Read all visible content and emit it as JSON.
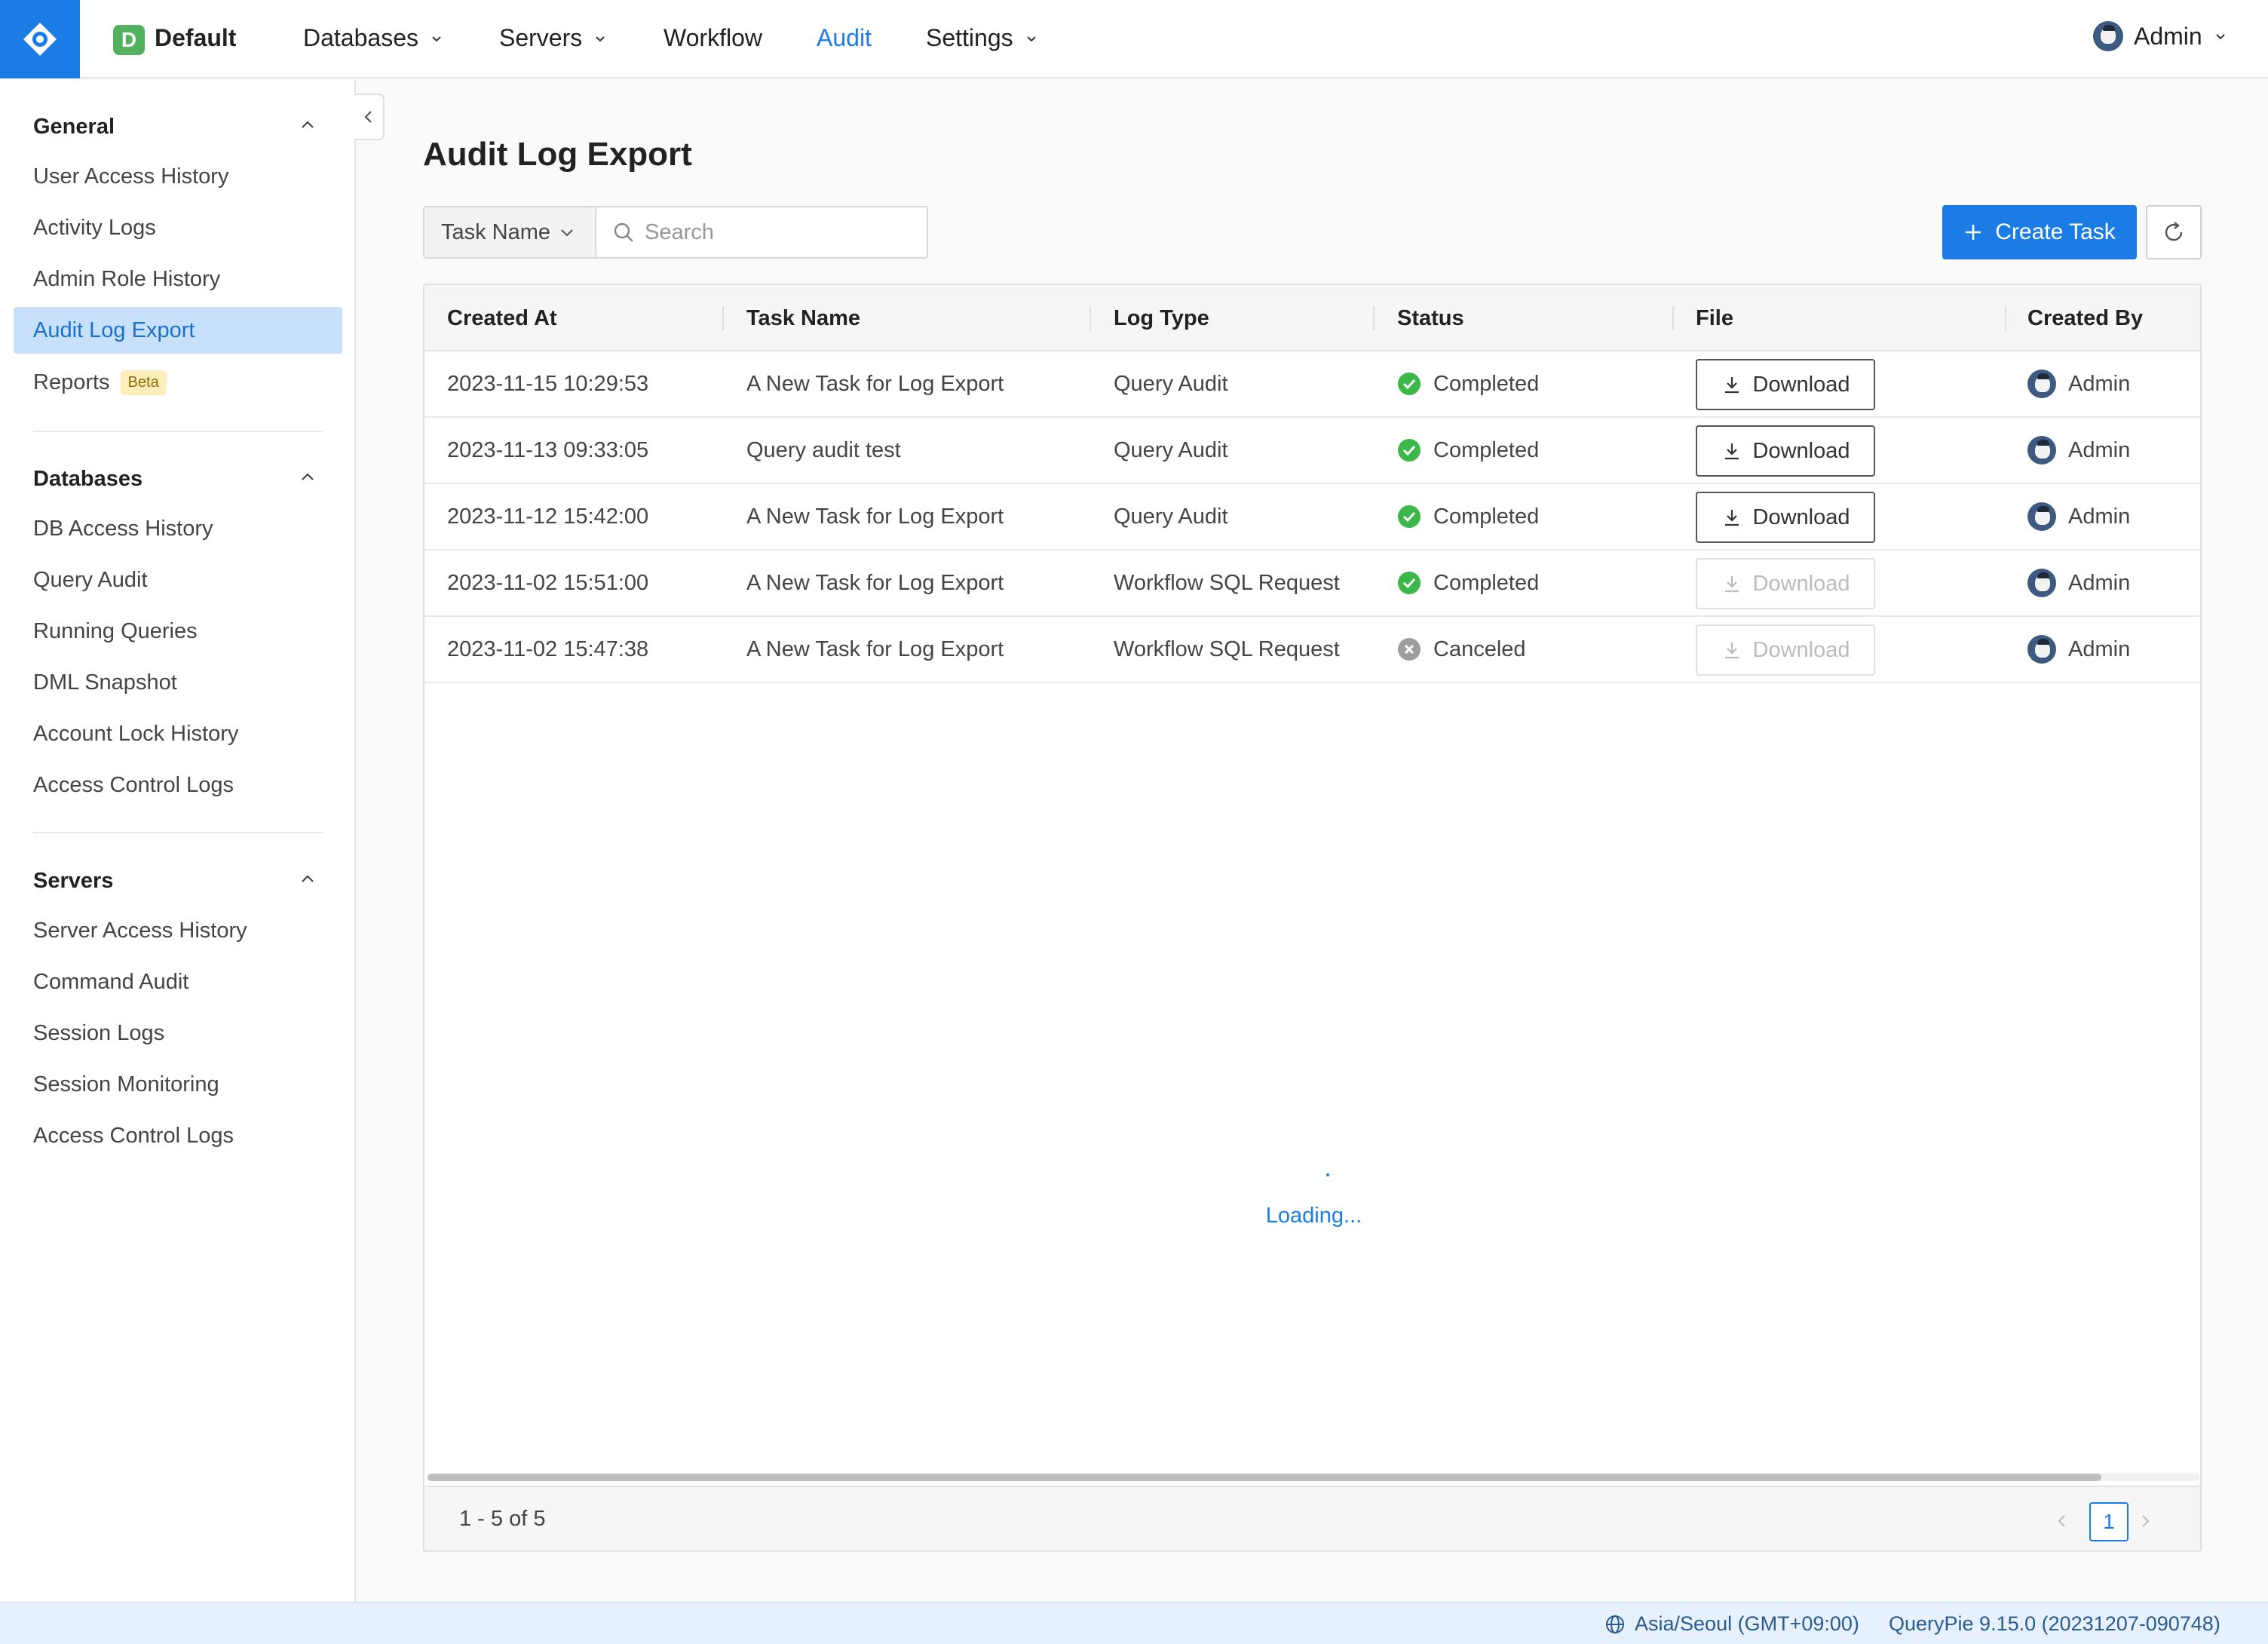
{
  "header": {
    "workspace_badge": "D",
    "workspace_name": "Default",
    "nav": [
      {
        "label": "Databases",
        "has_caret": true
      },
      {
        "label": "Servers",
        "has_caret": true
      },
      {
        "label": "Workflow",
        "has_caret": false
      },
      {
        "label": "Audit",
        "has_caret": false,
        "active": true
      },
      {
        "label": "Settings",
        "has_caret": true
      }
    ],
    "user_name": "Admin"
  },
  "sidebar": {
    "sections": [
      {
        "title": "General",
        "items": [
          "User Access History",
          "Activity Logs",
          "Admin Role History",
          "Audit Log Export",
          "Reports"
        ]
      },
      {
        "title": "Databases",
        "items": [
          "DB Access History",
          "Query Audit",
          "Running Queries",
          "DML Snapshot",
          "Account Lock History",
          "Access Control Logs"
        ]
      },
      {
        "title": "Servers",
        "items": [
          "Server Access History",
          "Command Audit",
          "Session Logs",
          "Session Monitoring",
          "Access Control Logs"
        ]
      }
    ],
    "active_item": "Audit Log Export",
    "beta_badge": "Beta"
  },
  "main": {
    "title": "Audit Log Export",
    "filter_field": "Task Name",
    "search_placeholder": "Search",
    "create_button": "Create Task",
    "table": {
      "columns": [
        "Created At",
        "Task Name",
        "Log Type",
        "Status",
        "File",
        "Created By"
      ],
      "rows": [
        {
          "created_at": "2023-11-15 10:29:53",
          "task_name": "A New Task for Log Export",
          "log_type": "Query Audit",
          "status": "Completed",
          "file": "Download",
          "file_enabled": true,
          "created_by": "Admin"
        },
        {
          "created_at": "2023-11-13 09:33:05",
          "task_name": "Query audit test",
          "log_type": "Query Audit",
          "status": "Completed",
          "file": "Download",
          "file_enabled": true,
          "created_by": "Admin"
        },
        {
          "created_at": "2023-11-12 15:42:00",
          "task_name": "A New Task for Log Export",
          "log_type": "Query Audit",
          "status": "Completed",
          "file": "Download",
          "file_enabled": true,
          "created_by": "Admin"
        },
        {
          "created_at": "2023-11-02 15:51:00",
          "task_name": "A New Task for Log Export",
          "log_type": "Workflow SQL Request",
          "status": "Completed",
          "file": "Download",
          "file_enabled": false,
          "created_by": "Admin"
        },
        {
          "created_at": "2023-11-02 15:47:38",
          "task_name": "A New Task for Log Export",
          "log_type": "Workflow SQL Request",
          "status": "Canceled",
          "file": "Download",
          "file_enabled": false,
          "created_by": "Admin"
        }
      ],
      "loading_text": "Loading...",
      "range_text": "1 - 5 of 5",
      "current_page": "1"
    }
  },
  "footer": {
    "timezone": "Asia/Seoul (GMT+09:00)",
    "version": "QueryPie 9.15.0 (20231207-090748)"
  },
  "colors": {
    "primary": "#1b7ce6",
    "success": "#3cb84a",
    "canceled": "#9e9e9e",
    "sidebar_active_bg": "#c8e1fb",
    "beta_bg": "#fdeebb"
  }
}
